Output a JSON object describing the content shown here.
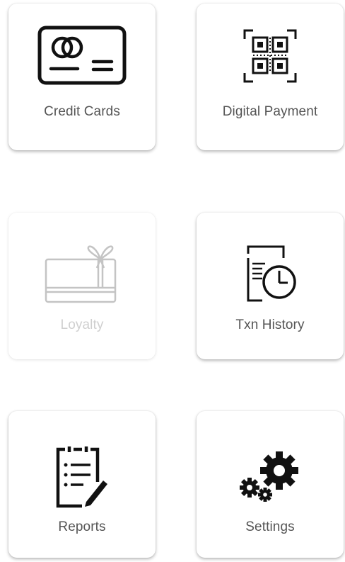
{
  "tiles": [
    {
      "id": "credit-cards",
      "label": "Credit Cards",
      "icon": "credit-card-icon",
      "enabled": true
    },
    {
      "id": "digital-payment",
      "label": "Digital Payment",
      "icon": "qr-code-icon",
      "enabled": true
    },
    {
      "id": "loyalty",
      "label": "Loyalty",
      "icon": "gift-card-icon",
      "enabled": false
    },
    {
      "id": "txn-history",
      "label": "Txn History",
      "icon": "transaction-history-icon",
      "enabled": true
    },
    {
      "id": "reports",
      "label": "Reports",
      "icon": "clipboard-report-icon",
      "enabled": true
    },
    {
      "id": "settings",
      "label": "Settings",
      "icon": "gears-icon",
      "enabled": true
    }
  ],
  "colors": {
    "icon": "#111111",
    "label": "#555555",
    "disabled": "#cfcfcf"
  }
}
